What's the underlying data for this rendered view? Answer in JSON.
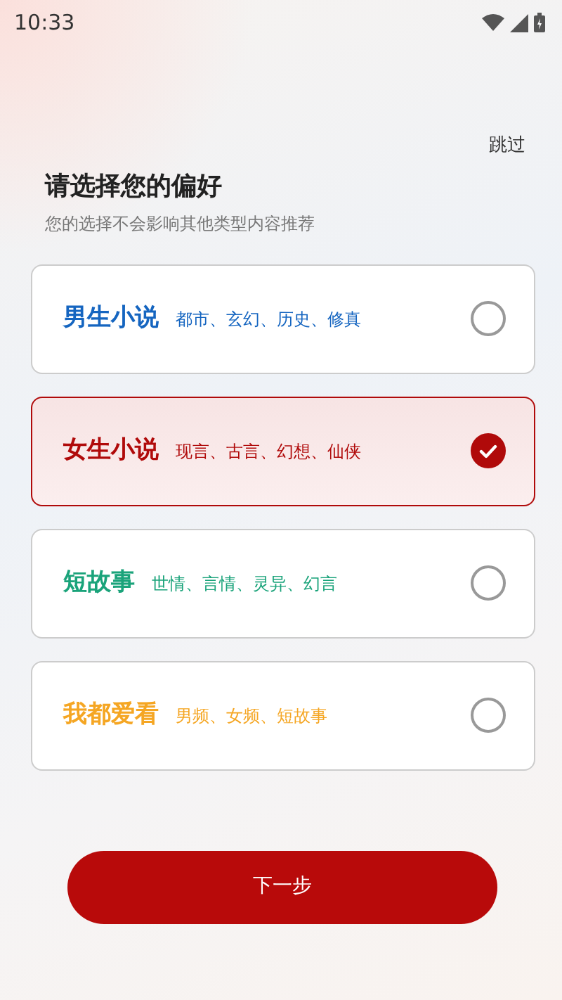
{
  "status_bar": {
    "time": "10:33"
  },
  "skip": "跳过",
  "title": "请选择您的偏好",
  "subtitle": "您的选择不会影响其他类型内容推荐",
  "options": [
    {
      "name": "男生小说",
      "tags": "都市、玄幻、历史、修真",
      "color": "#1565c0",
      "selected": false
    },
    {
      "name": "女生小说",
      "tags": "现言、古言、幻想、仙侠",
      "color": "#b00a0a",
      "selected": true
    },
    {
      "name": "短故事",
      "tags": "世情、言情、灵异、幻言",
      "color": "#1aa37a",
      "selected": false
    },
    {
      "name": "我都爱看",
      "tags": "男频、女频、短故事",
      "color": "#f5a623",
      "selected": false
    }
  ],
  "next_button": "下一步"
}
